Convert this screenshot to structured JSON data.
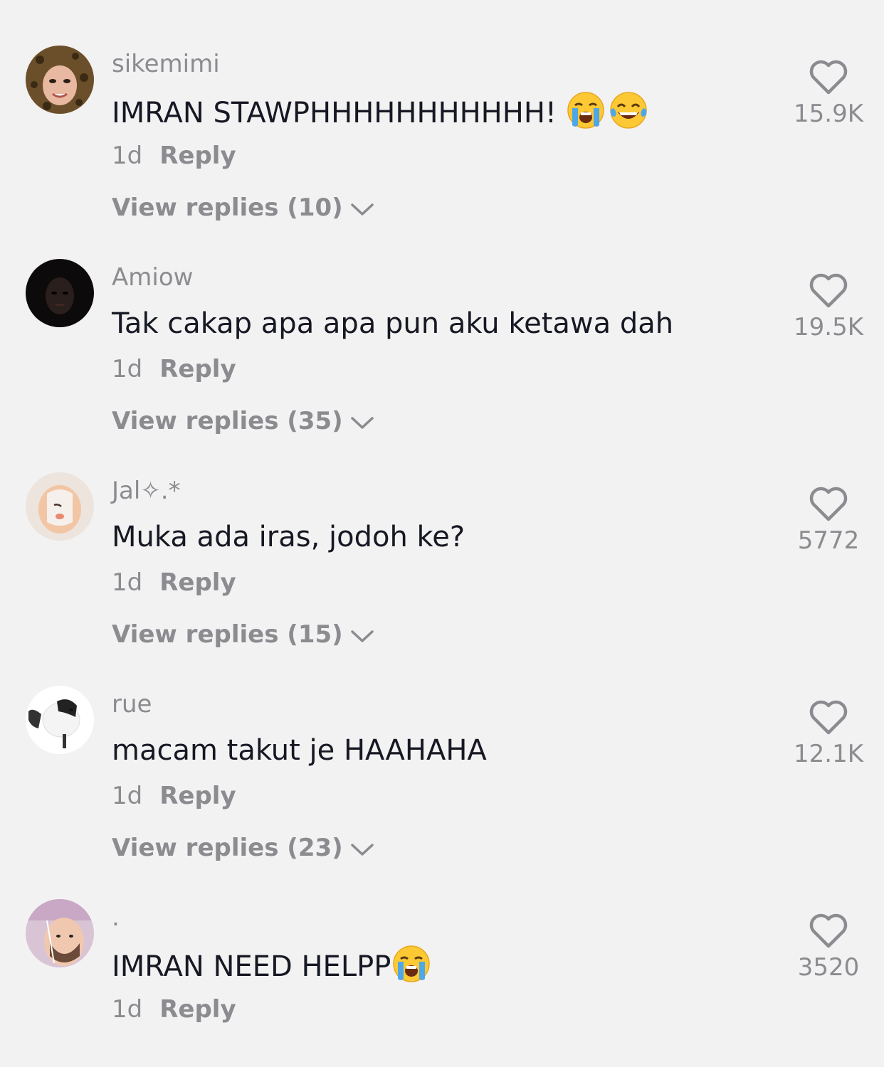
{
  "comments": [
    {
      "username": "sikemimi",
      "text": "IMRAN STAWPHHHHHHHHHHH!",
      "emojis": [
        "loudly-crying-face",
        "face-with-tears-of-joy"
      ],
      "time": "1d",
      "reply_label": "Reply",
      "view_replies": "View replies (10)",
      "likes": "15.9K"
    },
    {
      "username": "Amiow",
      "text": "Tak cakap apa apa pun aku ketawa dah",
      "emojis": [],
      "time": "1d",
      "reply_label": "Reply",
      "view_replies": "View replies (35)",
      "likes": "19.5K"
    },
    {
      "username": "Jal✧.*",
      "text": "Muka ada iras, jodoh ke?",
      "emojis": [],
      "time": "1d",
      "reply_label": "Reply",
      "view_replies": "View replies (15)",
      "likes": "5772"
    },
    {
      "username": "rue",
      "text": "macam takut je HAAHAHA",
      "emojis": [],
      "time": "1d",
      "reply_label": "Reply",
      "view_replies": "View replies (23)",
      "likes": "12.1K"
    },
    {
      "username": ".",
      "text": "IMRAN NEED HELPP",
      "emojis": [
        "loudly-crying-face"
      ],
      "time": "1d",
      "reply_label": "Reply",
      "likes": "3520"
    }
  ]
}
